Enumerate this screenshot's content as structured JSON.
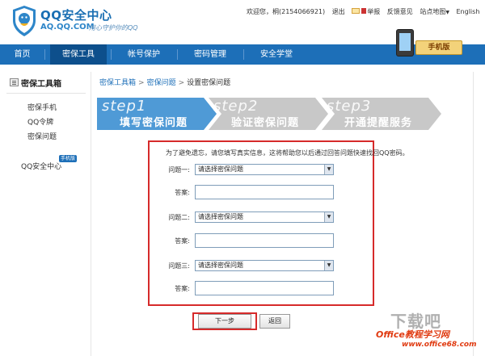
{
  "header": {
    "title": "QQ安全中心",
    "domain": "AQ.QQ.COM",
    "slogan": "用心守护你的QQ",
    "welcome": "欢迎您，桐(2154066921)",
    "logout": "退出",
    "report": "举报",
    "feedback": "反馈意见",
    "sitemap": "站点地图",
    "english": "English",
    "phone_tag": "手机版"
  },
  "nav": {
    "items": [
      {
        "label": "首页"
      },
      {
        "label": "密保工具"
      },
      {
        "label": "帐号保护"
      },
      {
        "label": "密码管理"
      },
      {
        "label": "安全学堂"
      }
    ]
  },
  "sidebar": {
    "heading": "密保工具箱",
    "items": [
      {
        "label": "密保手机"
      },
      {
        "label": "QQ令牌"
      },
      {
        "label": "密保问题"
      }
    ],
    "qq_center": "QQ安全中心",
    "qq_center_badge": "手机版"
  },
  "breadcrumb": {
    "items": [
      "密保工具箱",
      "密保问题",
      "设置密保问题"
    ],
    "sep": ">"
  },
  "steps": [
    {
      "en": "step1",
      "cn": "填写密保问题"
    },
    {
      "en": "step2",
      "cn": "验证密保问题"
    },
    {
      "en": "step3",
      "cn": "开通提醒服务"
    }
  ],
  "form": {
    "tip": "为了避免遗忘，请您填写真实信息，这将帮助您以后通过回答问题快速找回QQ密码。",
    "questions": [
      {
        "label": "问题一:",
        "select": "请选择密保问题",
        "answer_label": "答案:"
      },
      {
        "label": "问题二:",
        "select": "请选择密保问题",
        "answer_label": "答案:"
      },
      {
        "label": "问题三:",
        "select": "请选择密保问题",
        "answer_label": "答案:"
      }
    ],
    "next": "下一步",
    "back": "返回"
  },
  "watermark": {
    "big": "下载吧",
    "logo": "Office教程学习网",
    "url": "www.office68.com"
  },
  "colors": {
    "nav": "#1d6fb8",
    "nav_active": "#0d4f8c",
    "step_active": "#4f9ad6",
    "step_inactive": "#c4c4c4",
    "highlight": "#d62a2a"
  }
}
